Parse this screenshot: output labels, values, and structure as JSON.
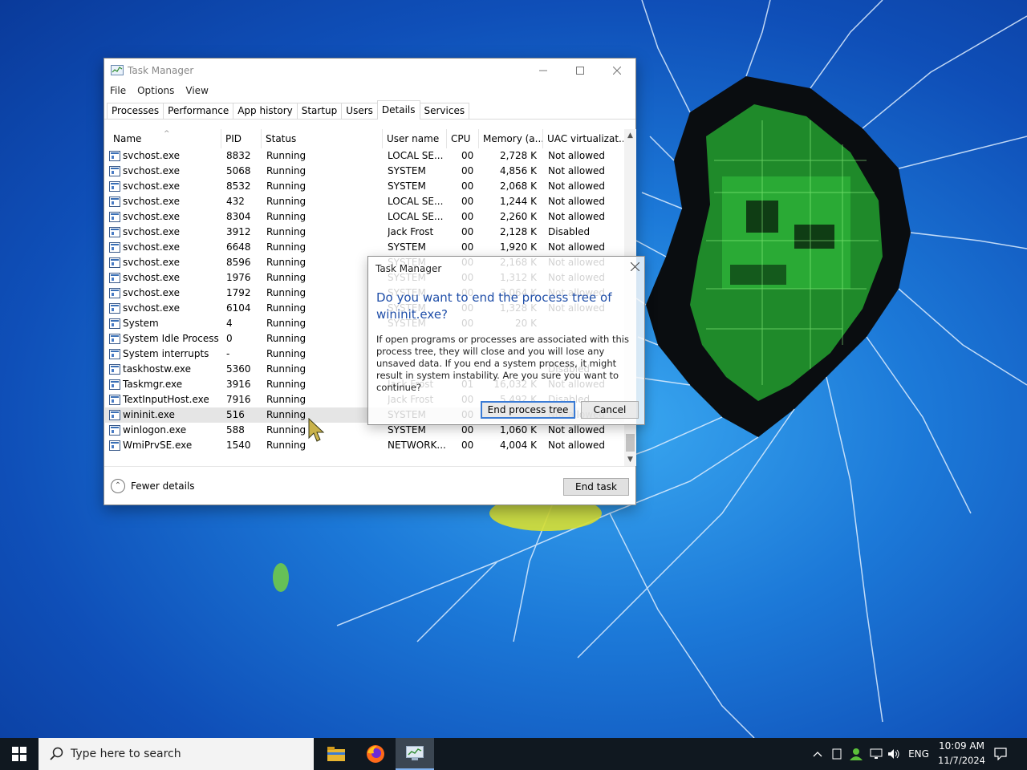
{
  "window": {
    "title": "Task Manager",
    "menu": [
      "File",
      "Options",
      "View"
    ],
    "tabs": [
      "Processes",
      "Performance",
      "App history",
      "Startup",
      "Users",
      "Details",
      "Services"
    ],
    "active_tab": "Details"
  },
  "columns": [
    "Name",
    "PID",
    "Status",
    "User name",
    "CPU",
    "Memory (a...",
    "UAC virtualizat..."
  ],
  "rows": [
    {
      "name": "svchost.exe",
      "pid": "8832",
      "status": "Running",
      "user": "LOCAL SE...",
      "cpu": "00",
      "mem": "2,728 K",
      "uac": "Not allowed"
    },
    {
      "name": "svchost.exe",
      "pid": "5068",
      "status": "Running",
      "user": "SYSTEM",
      "cpu": "00",
      "mem": "4,856 K",
      "uac": "Not allowed"
    },
    {
      "name": "svchost.exe",
      "pid": "8532",
      "status": "Running",
      "user": "SYSTEM",
      "cpu": "00",
      "mem": "2,068 K",
      "uac": "Not allowed"
    },
    {
      "name": "svchost.exe",
      "pid": "432",
      "status": "Running",
      "user": "LOCAL SE...",
      "cpu": "00",
      "mem": "1,244 K",
      "uac": "Not allowed"
    },
    {
      "name": "svchost.exe",
      "pid": "8304",
      "status": "Running",
      "user": "LOCAL SE...",
      "cpu": "00",
      "mem": "2,260 K",
      "uac": "Not allowed"
    },
    {
      "name": "svchost.exe",
      "pid": "3912",
      "status": "Running",
      "user": "Jack Frost",
      "cpu": "00",
      "mem": "2,128 K",
      "uac": "Disabled"
    },
    {
      "name": "svchost.exe",
      "pid": "6648",
      "status": "Running",
      "user": "SYSTEM",
      "cpu": "00",
      "mem": "1,920 K",
      "uac": "Not allowed"
    },
    {
      "name": "svchost.exe",
      "pid": "8596",
      "status": "Running",
      "user": "SYSTEM",
      "cpu": "00",
      "mem": "2,168 K",
      "uac": "Not allowed"
    },
    {
      "name": "svchost.exe",
      "pid": "1976",
      "status": "Running",
      "user": "SYSTEM",
      "cpu": "00",
      "mem": "1,312 K",
      "uac": "Not allowed"
    },
    {
      "name": "svchost.exe",
      "pid": "1792",
      "status": "Running",
      "user": "SYSTEM",
      "cpu": "00",
      "mem": "3,064 K",
      "uac": "Not allowed"
    },
    {
      "name": "svchost.exe",
      "pid": "6104",
      "status": "Running",
      "user": "SYSTEM",
      "cpu": "00",
      "mem": "1,328 K",
      "uac": "Not allowed"
    },
    {
      "name": "System",
      "pid": "4",
      "status": "Running",
      "user": "SYSTEM",
      "cpu": "00",
      "mem": "20 K",
      "uac": ""
    },
    {
      "name": "System Idle Process",
      "pid": "0",
      "status": "Running",
      "user": "",
      "cpu": "",
      "mem": "",
      "uac": ""
    },
    {
      "name": "System interrupts",
      "pid": "-",
      "status": "Running",
      "user": "",
      "cpu": "",
      "mem": "",
      "uac": ""
    },
    {
      "name": "taskhostw.exe",
      "pid": "5360",
      "status": "Running",
      "user": "",
      "cpu": "",
      "mem": "",
      "uac": "Disabled"
    },
    {
      "name": "Taskmgr.exe",
      "pid": "3916",
      "status": "Running",
      "user": "Jack Frost",
      "cpu": "01",
      "mem": "16,032 K",
      "uac": "Not allowed"
    },
    {
      "name": "TextInputHost.exe",
      "pid": "7916",
      "status": "Running",
      "user": "Jack Frost",
      "cpu": "00",
      "mem": "5,492 K",
      "uac": "Disabled"
    },
    {
      "name": "wininit.exe",
      "pid": "516",
      "status": "Running",
      "user": "SYSTEM",
      "cpu": "00",
      "mem": "",
      "uac": "Not allowed"
    },
    {
      "name": "winlogon.exe",
      "pid": "588",
      "status": "Running",
      "user": "SYSTEM",
      "cpu": "00",
      "mem": "1,060 K",
      "uac": "Not allowed"
    },
    {
      "name": "WmiPrvSE.exe",
      "pid": "1540",
      "status": "Running",
      "user": "NETWORK...",
      "cpu": "00",
      "mem": "4,004 K",
      "uac": "Not allowed"
    }
  ],
  "selected_row": "wininit.exe",
  "footer": {
    "fewer_details": "Fewer details",
    "end_task": "End task"
  },
  "dialog": {
    "title": "Task Manager",
    "heading": "Do you want to end the process tree of wininit.exe?",
    "body": "If open programs or processes are associated with this process tree, they will close and you will lose any unsaved data. If you end a system process, it might result in system instability. Are you sure you want to continue?",
    "confirm": "End process tree",
    "cancel": "Cancel"
  },
  "taskbar": {
    "search_placeholder": "Type here to search",
    "language": "ENG",
    "time": "10:09 AM",
    "date": "11/7/2024"
  },
  "colors": {
    "heading_blue": "#1f4ea8",
    "focus_blue": "#3a7bd5",
    "taskbar": "#101820"
  }
}
